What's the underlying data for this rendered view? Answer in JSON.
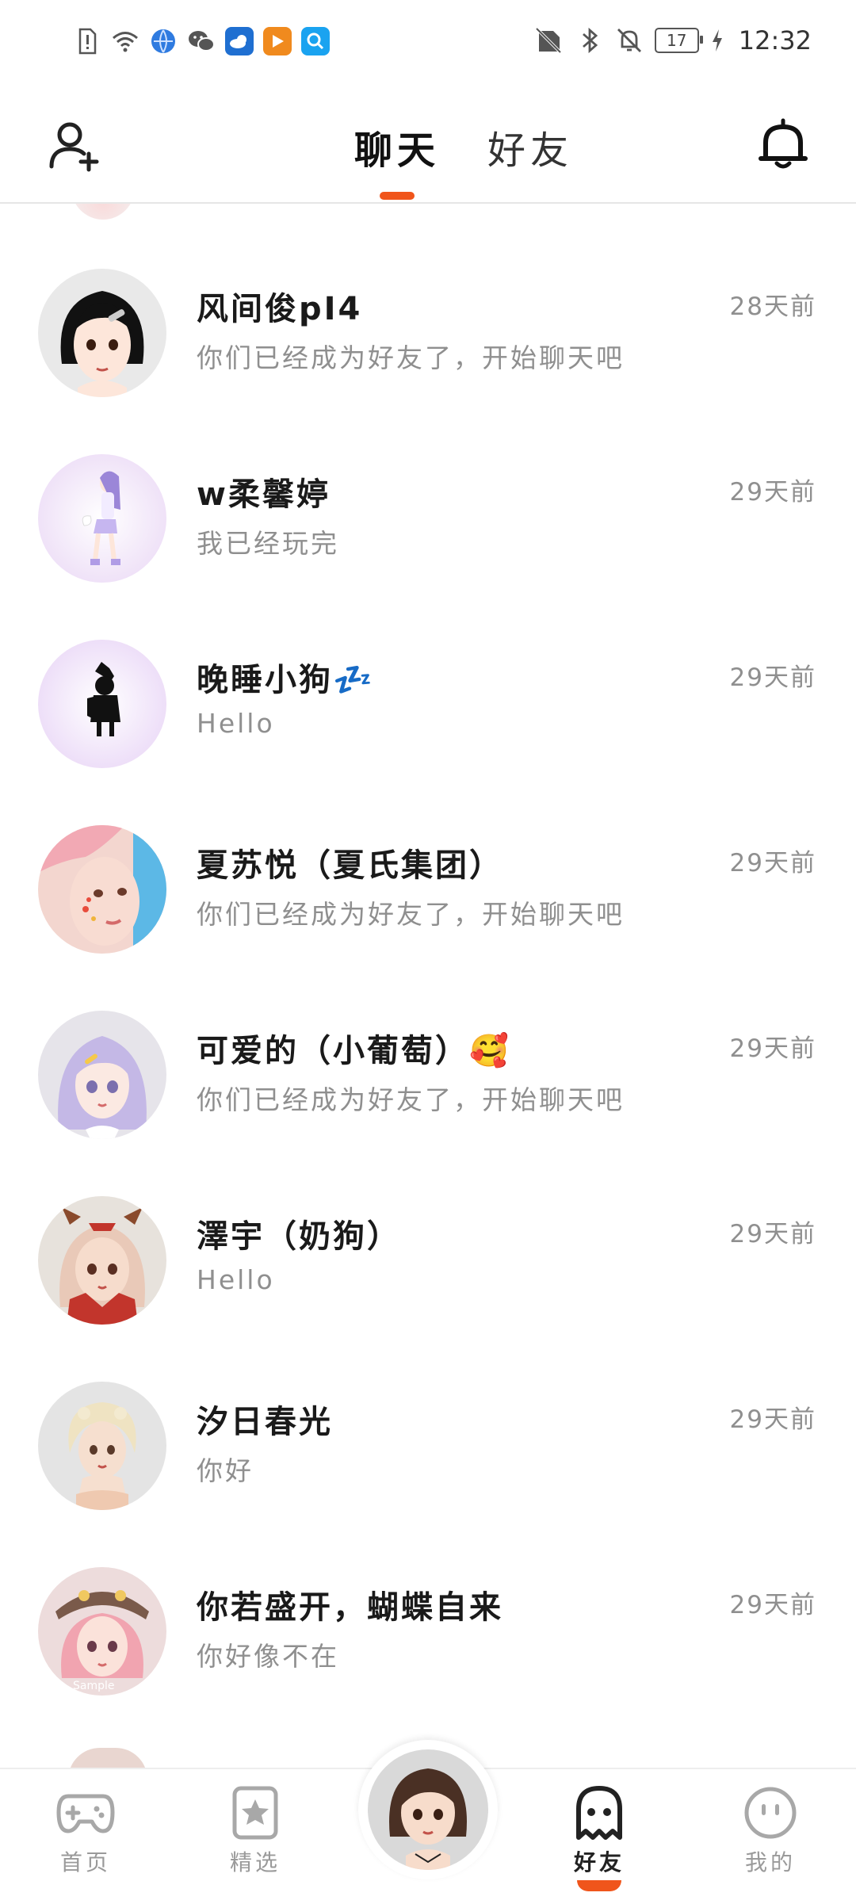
{
  "status_bar": {
    "battery": "17",
    "time": "12:32",
    "left_icons": [
      "alert-icon",
      "wifi-icon",
      "browser-app-icon",
      "wechat-icon",
      "weather-app-icon",
      "video-app-icon",
      "search-app-icon"
    ],
    "right_icons": [
      "no-sim-icon",
      "bluetooth-icon",
      "mute-icon",
      "battery-icon",
      "charging-icon"
    ]
  },
  "header": {
    "tabs": [
      {
        "label": "聊天",
        "active": true
      },
      {
        "label": "好友",
        "active": false
      }
    ],
    "left_icon": "add-friend-icon",
    "right_icon": "bell-icon",
    "accent_color": "#f0551b"
  },
  "chats": [
    {
      "name": "风间俊pI4",
      "preview": "你们已经成为好友了，开始聊天吧",
      "time": "28天前"
    },
    {
      "name": "w柔馨婷",
      "preview": "我已经玩完",
      "time": "29天前"
    },
    {
      "name": "晚睡小狗",
      "name_emoji": "💤",
      "preview": "Hello",
      "time": "29天前"
    },
    {
      "name": "夏苏悦（夏氏集团）",
      "preview": "你们已经成为好友了，开始聊天吧",
      "time": "29天前"
    },
    {
      "name": "可爱的（小葡萄）",
      "name_emoji": "🥰",
      "preview": "你们已经成为好友了，开始聊天吧",
      "time": "29天前"
    },
    {
      "name": "澤宇（奶狗）",
      "preview": "Hello",
      "time": "29天前"
    },
    {
      "name": "汐日春光",
      "preview": "你好",
      "time": "29天前"
    },
    {
      "name": "你若盛开，蝴蝶自来",
      "preview": "你好像不在",
      "time": "29天前"
    }
  ],
  "bottom_nav": [
    {
      "label": "首页",
      "icon": "gamepad-icon",
      "active": false
    },
    {
      "label": "精选",
      "icon": "star-icon",
      "active": false
    },
    {
      "label": "",
      "icon": "profile-avatar",
      "active": false
    },
    {
      "label": "好友",
      "icon": "ghost-icon",
      "active": true
    },
    {
      "label": "我的",
      "icon": "smiley-icon",
      "active": false
    }
  ]
}
